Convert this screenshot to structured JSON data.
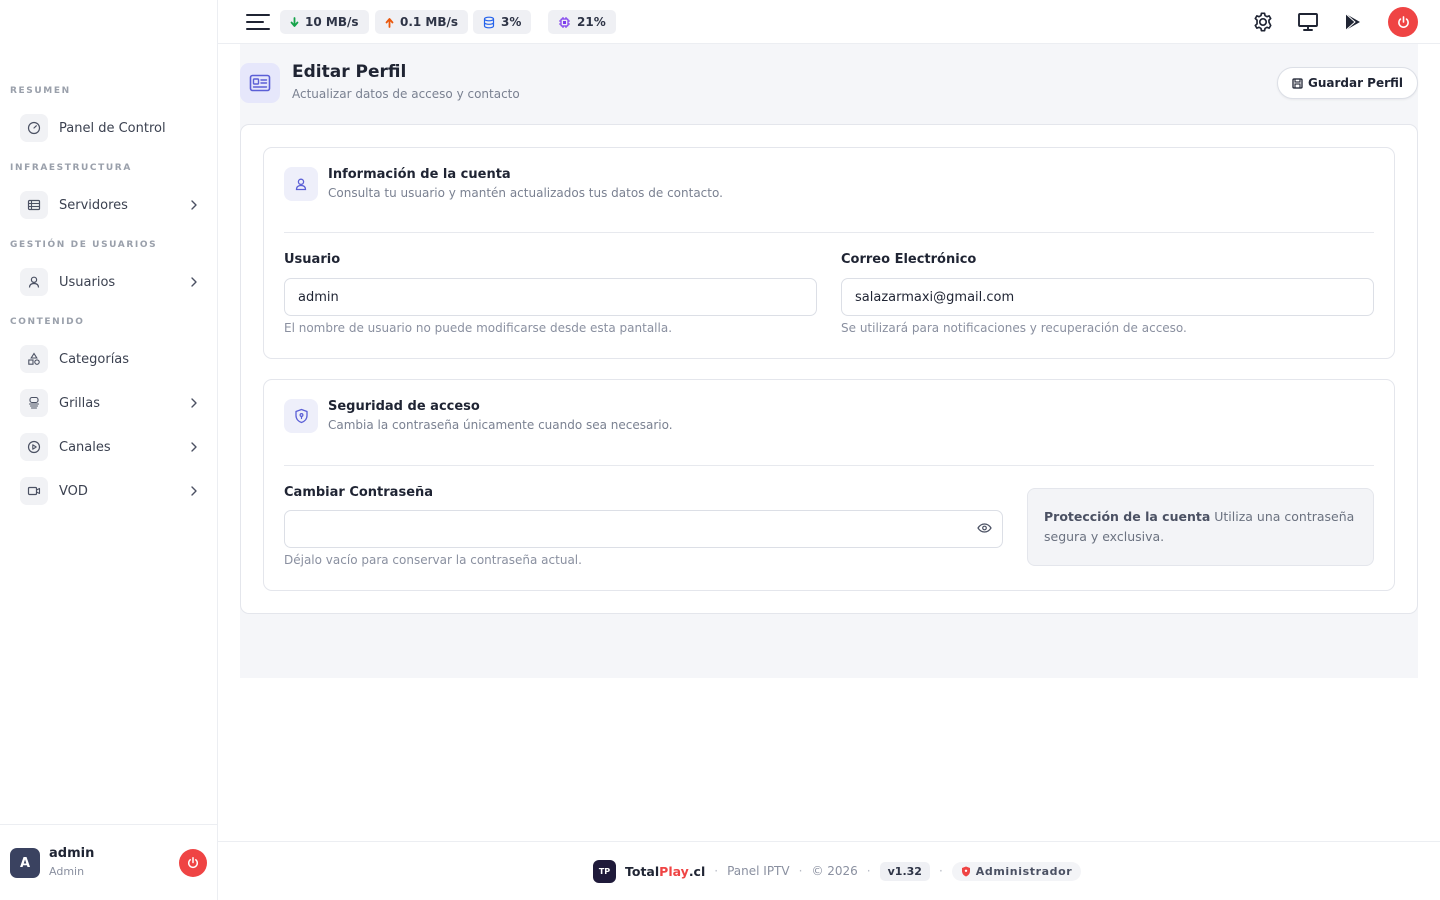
{
  "sidebar": {
    "sections": [
      "RESUMEN",
      "INFRAESTRUCTURA",
      "GESTIÓN DE USUARIOS",
      "CONTENIDO"
    ],
    "items": [
      {
        "label": "Panel de Control",
        "icon": "dashboard-icon"
      },
      {
        "label": "Servidores",
        "icon": "server-icon"
      },
      {
        "label": "Usuarios",
        "icon": "user-icon"
      },
      {
        "label": "Categorías",
        "icon": "shapes-icon"
      },
      {
        "label": "Grillas",
        "icon": "grid-icon"
      },
      {
        "label": "Canales",
        "icon": "play-circle-icon"
      },
      {
        "label": "VOD",
        "icon": "video-icon"
      }
    ],
    "user": {
      "initial": "A",
      "name": "admin",
      "role": "Admin"
    }
  },
  "topbar": {
    "stats": [
      {
        "value": "10 MB/s",
        "icon": "arrow-down-icon",
        "color": "#16a34a"
      },
      {
        "value": "0.1 MB/s",
        "icon": "arrow-up-icon",
        "color": "#ea580c"
      },
      {
        "value": "3%",
        "icon": "database-icon",
        "color": "#2563eb"
      },
      {
        "value": "21%",
        "icon": "cpu-icon",
        "color": "#7c3aed"
      }
    ]
  },
  "header": {
    "title": "Editar Perfil",
    "subtitle": "Actualizar datos de acceso y contacto",
    "save_label": "Guardar Perfil"
  },
  "account": {
    "title": "Información de la cuenta",
    "desc": "Consulta tu usuario y mantén actualizados tus datos de contacto.",
    "username_label": "Usuario",
    "username_value": "admin",
    "username_help": "El nombre de usuario no puede modificarse desde esta pantalla.",
    "email_label": "Correo Electrónico",
    "email_value": "salazarmaxi@gmail.com",
    "email_help": "Se utilizará para notificaciones y recuperación de acceso."
  },
  "security": {
    "title": "Seguridad de acceso",
    "desc": "Cambia la contraseña únicamente cuando sea necesario.",
    "password_label": "Cambiar Contraseña",
    "password_value": "",
    "password_help": "Déjalo vacío para conservar la contraseña actual.",
    "protect_title": "Protección de la cuenta",
    "protect_text": "Utiliza una contraseña segura y exclusiva."
  },
  "footer": {
    "logo": "TP",
    "brand": "Total",
    "brand_accent": "Play",
    "brand_suffix": ".cl",
    "product": "Panel IPTV",
    "copyright": "© 2026",
    "version": "v1.32",
    "role": "Administrador"
  },
  "colors": {
    "accent": "#5b5fd6",
    "danger": "#ef4444"
  }
}
